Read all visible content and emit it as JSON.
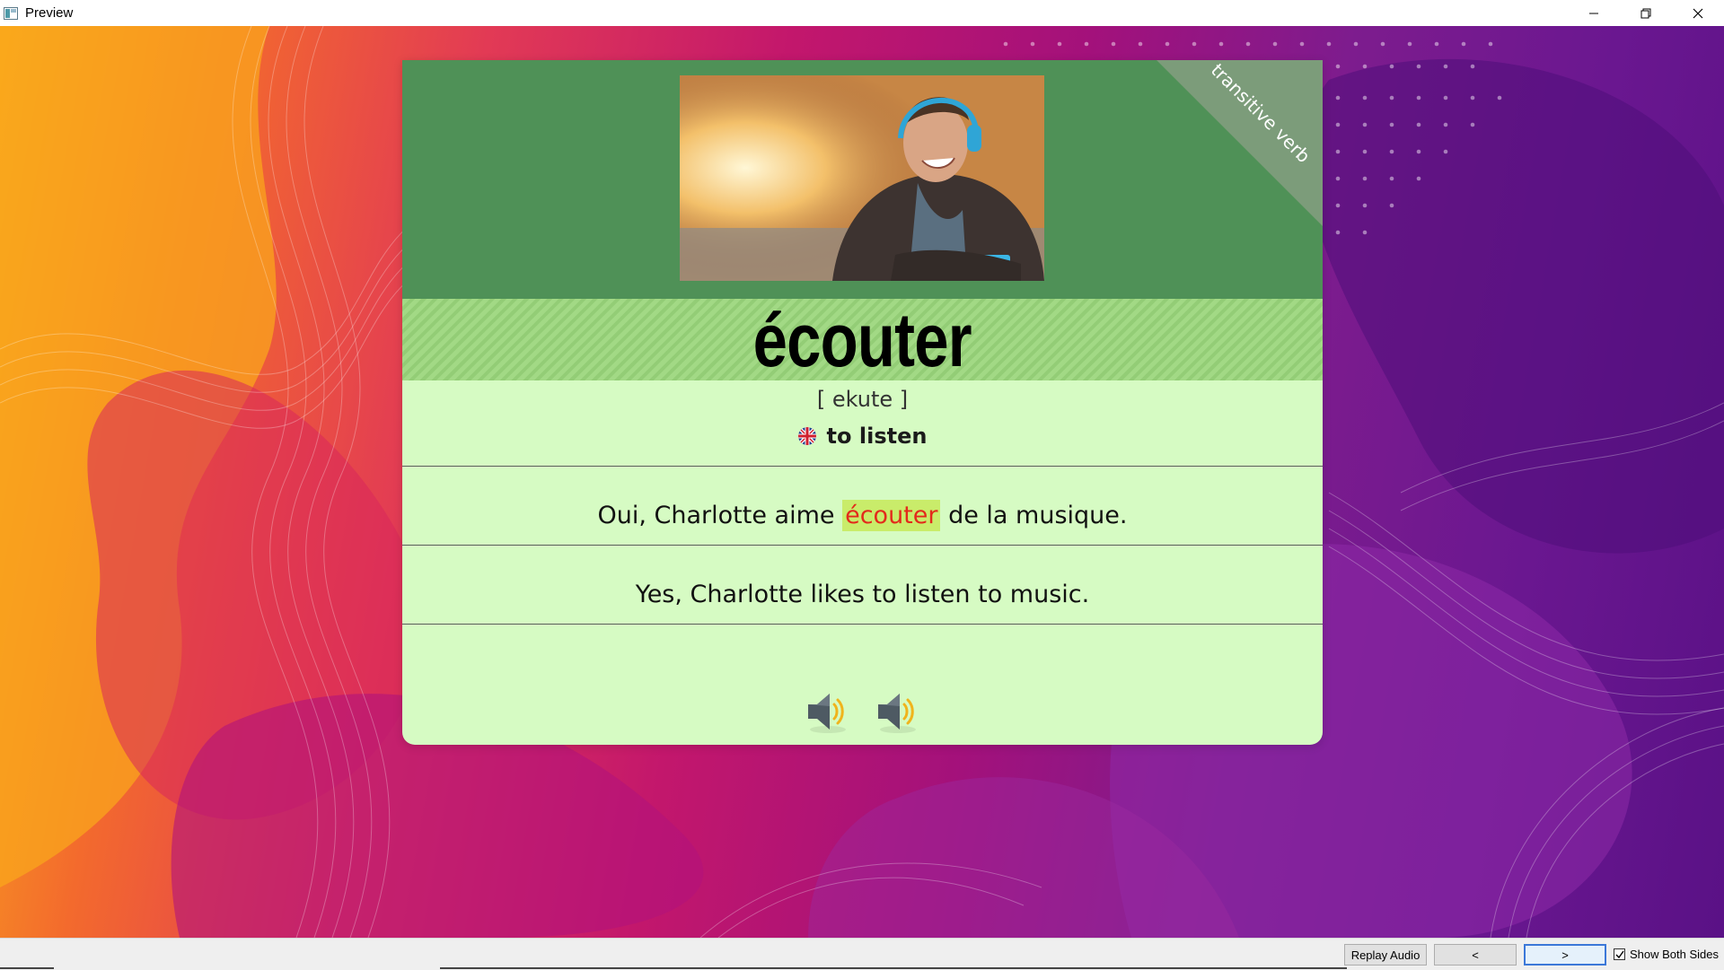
{
  "window": {
    "title": "Preview",
    "controls": [
      "minimize-icon",
      "restore-icon",
      "close-icon"
    ]
  },
  "card": {
    "part_of_speech": "transitive verb",
    "headword": "écouter",
    "phonetic": "[ ekute ]",
    "translation_flag": "uk-flag-icon",
    "translation": "to listen",
    "example": {
      "before": "Oui, Charlotte aime ",
      "highlight": "écouter",
      "after": " de la musique."
    },
    "example_translation": "Yes, Charlotte likes to listen to music.",
    "audio_buttons": [
      "speaker-icon",
      "speaker-icon"
    ]
  },
  "colors": {
    "header_green": "#4f9157",
    "card_bg": "#d6fbc3",
    "highlight_bg": "#c9ec6a",
    "highlight_text": "#e32a1b"
  },
  "bottombar": {
    "replay_label": "Replay Audio",
    "prev_label": "<",
    "next_label": ">",
    "show_both_label": "Show Both Sides",
    "show_both_checked": true
  }
}
